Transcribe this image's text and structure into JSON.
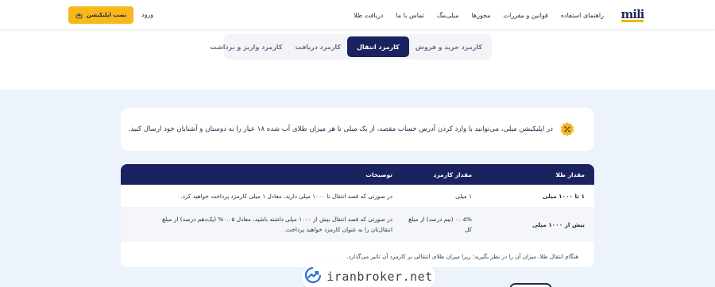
{
  "header": {
    "logo_text": "mili",
    "nav": [
      "راهنمای استفاده",
      "قوانین و مقررات",
      "مجوزها",
      "میلی‌مگ",
      "تماس با ما",
      "دریافت طلا"
    ],
    "login_label": "ورود",
    "install_label": "نصب اپلیکیشن"
  },
  "tabs": [
    "کارمزد خرید و فروش",
    "کارمزد انتقال",
    "کارمزد دریافت",
    "کارمزد واریز و برداشت"
  ],
  "active_tab_index": 1,
  "info": {
    "text": "در اپلیکیشن میلی، می‌توانید با وارد کردن آدرس حساب مقصد، از یک میلی تا هر میزان طلای آب شده ۱۸ عیار را به دوستان و آشنایان خود ارسال کنید."
  },
  "table": {
    "headers": [
      "مقدار طلا",
      "مقدار کارمزد",
      "توضیحات"
    ],
    "rows": [
      [
        "۱ تا ۱۰۰۰ میلی",
        "۱ میلی",
        "در صورتی که قصد انتقال تا ۱۰۰۰ میلی دارید، معادل ۱ میلی کارمزد پرداخت خواهید کرد."
      ],
      [
        "بیش از ۱۰۰۰ میلی",
        "۰.۰۵% (نیم درصد) از مبلغ کل",
        "در صورتی که قصد انتقال بیش از ۱۰۰۰ میلی داشته باشید، معادل ۰.۰۵% (یک‌دهم درصد) از مبلغ انتقال‌تان را به عنوان کارمزد خواهید پرداخت."
      ]
    ],
    "footnote": "هنگام انتقال طلا، میزان آن را در نظر بگیرید؛ زیرا میزان طلای انتقالی بر کارمزد آن تاثیر می‌گذارد."
  },
  "watermark": "iranbroker.net",
  "colors": {
    "navy": "#1a2360",
    "gold": "#f7b81c",
    "page_tint": "#edf3fb"
  },
  "icons": [
    "cloud-download-icon",
    "percent-badge-icon",
    "trend-logo-icon"
  ]
}
